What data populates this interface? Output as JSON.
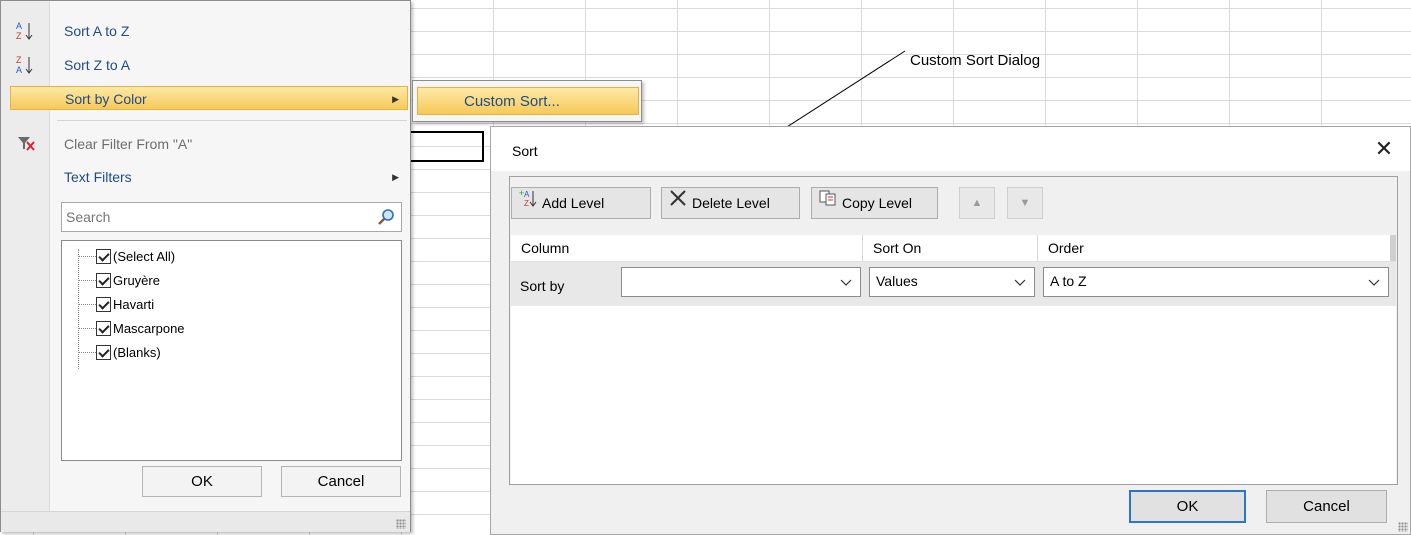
{
  "annotation": {
    "label": "Custom Sort Dialog"
  },
  "filter_menu": {
    "items": [
      {
        "label": "Sort A to Z",
        "icon": "sort-a-to-z-icon"
      },
      {
        "label": "Sort Z to A",
        "icon": "sort-z-to-a-icon"
      },
      {
        "label": "Sort by Color",
        "icon": "",
        "highlighted": true,
        "has_submenu": true
      },
      {
        "label": "Clear Filter From \"A\"",
        "icon": "clear-filter-icon",
        "disabled": true
      },
      {
        "label": "Text Filters",
        "icon": "",
        "has_submenu": true
      }
    ],
    "search": {
      "placeholder": "Search"
    },
    "list": [
      {
        "label": "(Select All)",
        "checked": true
      },
      {
        "label": "Gruyère",
        "checked": true
      },
      {
        "label": "Havarti",
        "checked": true
      },
      {
        "label": "Mascarpone",
        "checked": true
      },
      {
        "label": "(Blanks)",
        "checked": true
      }
    ],
    "ok_label": "OK",
    "cancel_label": "Cancel"
  },
  "submenu": {
    "label": "Custom Sort..."
  },
  "sort_dialog": {
    "title": "Sort",
    "close_glyph": "✕",
    "toolbar": {
      "add_level": "Add Level",
      "delete_level": "Delete Level",
      "copy_level": "Copy Level",
      "move_up": "▲",
      "move_down": "▼"
    },
    "columns": {
      "column": "Column",
      "sort_on": "Sort On",
      "order": "Order"
    },
    "row": {
      "label": "Sort by",
      "column_value": "",
      "sort_on_value": "Values",
      "order_value": "A to Z"
    },
    "ok_label": "OK",
    "cancel_label": "Cancel"
  },
  "colors": {
    "highlight": "#f7c959",
    "menu_text": "#1e4c8a",
    "primary_border": "#2a76c8"
  }
}
